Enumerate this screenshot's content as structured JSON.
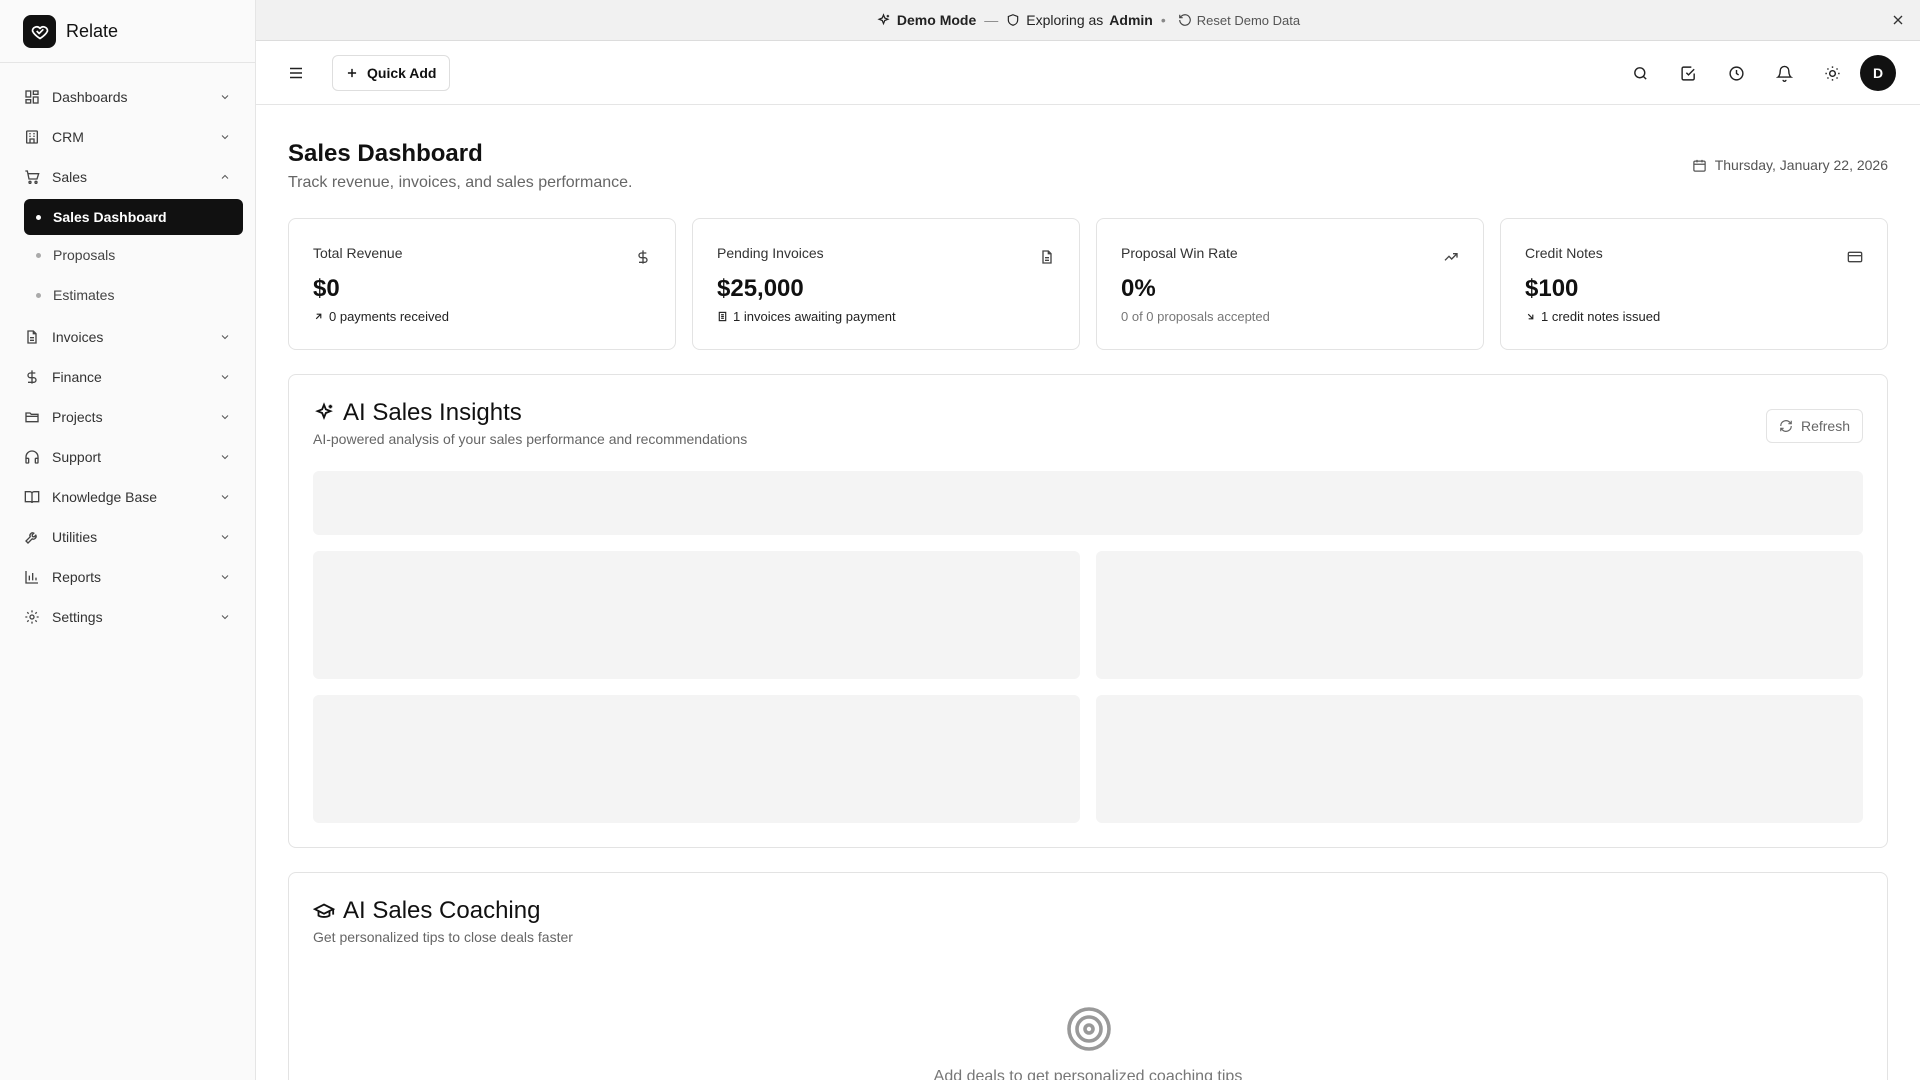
{
  "brand": {
    "name": "Relate"
  },
  "sidebar": {
    "items": [
      {
        "label": "Dashboards",
        "icon": "grid-icon"
      },
      {
        "label": "CRM",
        "icon": "building-icon"
      },
      {
        "label": "Sales",
        "icon": "cart-icon",
        "expanded": true,
        "children": [
          {
            "label": "Sales Dashboard",
            "active": true
          },
          {
            "label": "Proposals"
          },
          {
            "label": "Estimates"
          }
        ]
      },
      {
        "label": "Invoices",
        "icon": "file-icon"
      },
      {
        "label": "Finance",
        "icon": "dollar-icon"
      },
      {
        "label": "Projects",
        "icon": "folder-icon"
      },
      {
        "label": "Support",
        "icon": "headphones-icon"
      },
      {
        "label": "Knowledge Base",
        "icon": "book-icon"
      },
      {
        "label": "Utilities",
        "icon": "wrench-icon"
      },
      {
        "label": "Reports",
        "icon": "bar-chart-icon"
      },
      {
        "label": "Settings",
        "icon": "gear-icon"
      }
    ]
  },
  "banner": {
    "mode": "Demo Mode",
    "dash": "—",
    "exploring_prefix": "Exploring as",
    "role": "Admin",
    "bullet": "•",
    "reset": "Reset Demo Data"
  },
  "topbar": {
    "quick_add": "Quick Add",
    "avatar_initial": "D"
  },
  "page": {
    "title": "Sales Dashboard",
    "subtitle": "Track revenue, invoices, and sales performance.",
    "date": "Thursday, January 22, 2026"
  },
  "stats": [
    {
      "label": "Total Revenue",
      "value": "$0",
      "sub": "0 payments received",
      "icon": "dollar-icon"
    },
    {
      "label": "Pending Invoices",
      "value": "$25,000",
      "sub": "1 invoices awaiting payment",
      "icon": "file-text-icon"
    },
    {
      "label": "Proposal Win Rate",
      "value": "0%",
      "sub": "0 of 0 proposals accepted",
      "icon": "trending-up-icon"
    },
    {
      "label": "Credit Notes",
      "value": "$100",
      "sub": "1 credit notes issued",
      "icon": "credit-card-icon"
    }
  ],
  "insights": {
    "title": "AI Sales Insights",
    "subtitle": "AI-powered analysis of your sales performance and recommendations",
    "refresh": "Refresh"
  },
  "coaching": {
    "title": "AI Sales Coaching",
    "subtitle": "Get personalized tips to close deals faster",
    "empty": "Add deals to get personalized coaching tips"
  }
}
